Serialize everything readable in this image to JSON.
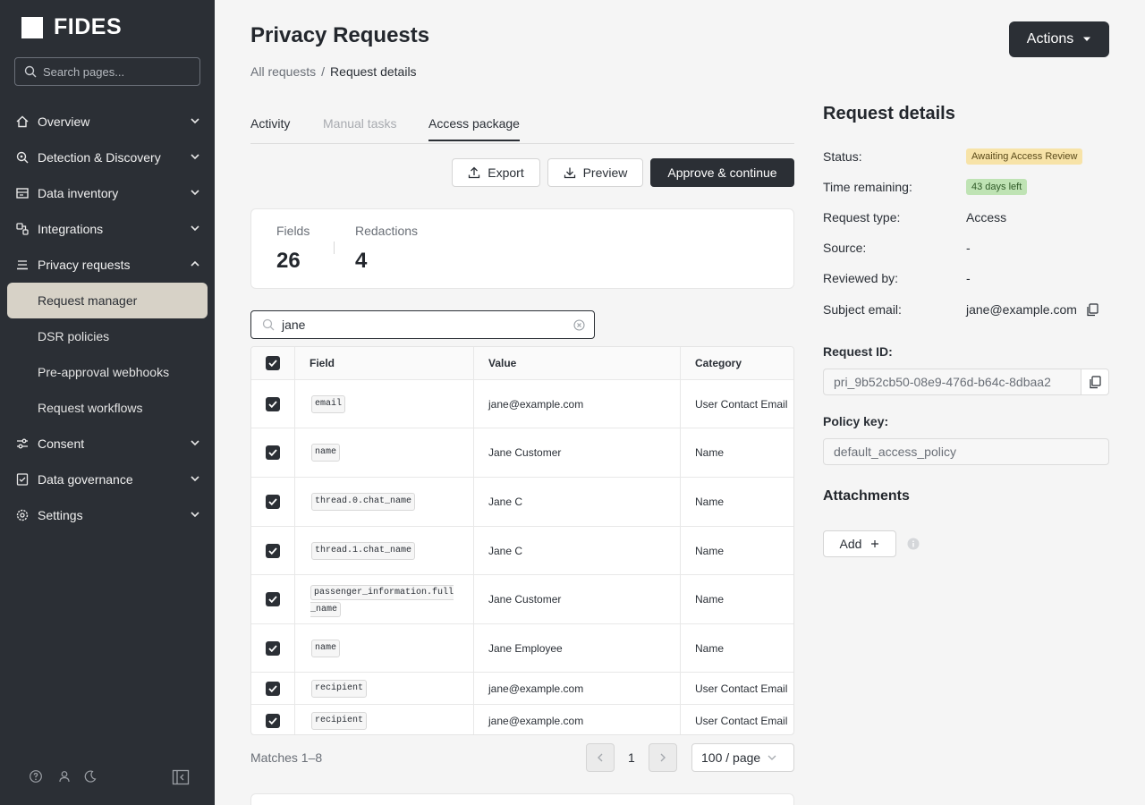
{
  "app": {
    "name": "FIDES"
  },
  "sidebar": {
    "search_placeholder": "Search pages...",
    "items": [
      {
        "label": "Overview",
        "icon": "home-icon",
        "expanded": false
      },
      {
        "label": "Detection & Discovery",
        "icon": "search-radar-icon",
        "expanded": false
      },
      {
        "label": "Data inventory",
        "icon": "inventory-icon",
        "expanded": false
      },
      {
        "label": "Integrations",
        "icon": "integrations-icon",
        "expanded": false
      },
      {
        "label": "Privacy requests",
        "icon": "privacy-requests-icon",
        "expanded": true,
        "children": [
          {
            "label": "Request manager",
            "active": true
          },
          {
            "label": "DSR policies",
            "active": false
          },
          {
            "label": "Pre-approval webhooks",
            "active": false
          },
          {
            "label": "Request workflows",
            "active": false
          }
        ]
      },
      {
        "label": "Consent",
        "icon": "sliders-icon",
        "expanded": false
      },
      {
        "label": "Data governance",
        "icon": "governance-icon",
        "expanded": false
      },
      {
        "label": "Settings",
        "icon": "gear-icon",
        "expanded": false
      }
    ],
    "footer_icons": [
      "help-icon",
      "user-icon",
      "moon-icon",
      "collapse-sidebar-icon"
    ]
  },
  "header": {
    "title": "Privacy Requests",
    "actions_label": "Actions",
    "breadcrumb": [
      "All requests",
      "Request details"
    ]
  },
  "tabs": [
    {
      "label": "Activity",
      "state": "normal"
    },
    {
      "label": "Manual tasks",
      "state": "disabled"
    },
    {
      "label": "Access package",
      "state": "active"
    }
  ],
  "toolbar": {
    "export_label": "Export",
    "preview_label": "Preview",
    "approve_label": "Approve & continue"
  },
  "stats": {
    "fields_label": "Fields",
    "fields_value": "26",
    "redactions_label": "Redactions",
    "redactions_value": "4"
  },
  "filter": {
    "value": "jane"
  },
  "table": {
    "columns": [
      "Field",
      "Value",
      "Category"
    ],
    "rows": [
      {
        "field": "email",
        "value": "jane@example.com",
        "category": "User Contact Email",
        "checked": true
      },
      {
        "field": "name",
        "value": "Jane Customer",
        "category": "Name",
        "checked": true
      },
      {
        "field": "thread.0.chat_name",
        "value": "Jane C",
        "category": "Name",
        "checked": true
      },
      {
        "field": "thread.1.chat_name",
        "value": "Jane C",
        "category": "Name",
        "checked": true
      },
      {
        "field": "passenger_information.full_name",
        "value": "Jane Customer",
        "category": "Name",
        "checked": true
      },
      {
        "field": "name",
        "value": "Jane Employee",
        "category": "Name",
        "checked": true
      },
      {
        "field": "recipient",
        "value": "jane@example.com",
        "category": "User Contact Email",
        "checked": true
      },
      {
        "field": "recipient",
        "value": "jane@example.com",
        "category": "User Contact Email",
        "checked": true
      }
    ]
  },
  "pagination": {
    "matches": "Matches 1–8",
    "page": "1",
    "page_size": "100 / page"
  },
  "details": {
    "title": "Request details",
    "status_label": "Status:",
    "status_value": "Awaiting Access Review",
    "time_label": "Time remaining:",
    "time_value": "43 days left",
    "type_label": "Request type:",
    "type_value": "Access",
    "source_label": "Source:",
    "source_value": "-",
    "reviewed_label": "Reviewed by:",
    "reviewed_value": "-",
    "email_label": "Subject email:",
    "email_value": "jane@example.com",
    "request_id_label": "Request ID:",
    "request_id_value": "pri_9b52cb50-08e9-476d-b64c-8dbaa2",
    "policy_label": "Policy key:",
    "policy_value": "default_access_policy",
    "attachments_title": "Attachments",
    "add_label": "Add"
  },
  "colors": {
    "sidebar_bg": "#2b2f35",
    "active_nav": "#d7d2c7",
    "badge_warn": "#f7e3a8",
    "badge_ok": "#bfe3b4"
  }
}
